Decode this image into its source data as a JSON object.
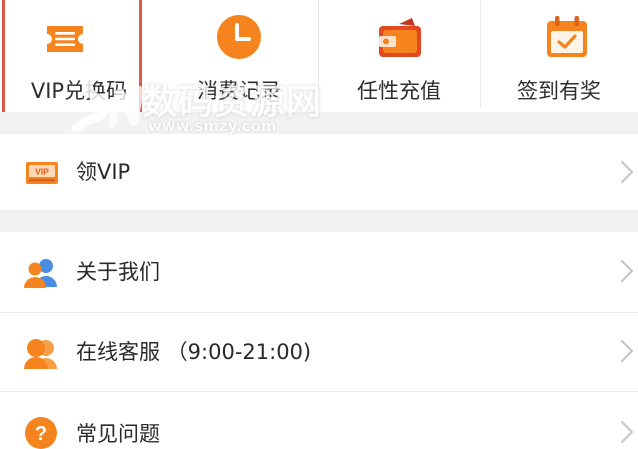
{
  "grid": {
    "items": [
      {
        "label": "VIP兑换码",
        "icon": "ticket-icon",
        "selected": true
      },
      {
        "label": "消费记录",
        "icon": "clock-icon",
        "selected": false
      },
      {
        "label": "任性充值",
        "icon": "wallet-icon",
        "selected": false
      },
      {
        "label": "签到有奖",
        "icon": "calendar-check-icon",
        "selected": false
      }
    ]
  },
  "list": {
    "get_vip": {
      "label": "领VIP",
      "icon": "vip-card-icon"
    },
    "about_us": {
      "label": "关于我们",
      "icon": "users-icon"
    },
    "online_service": {
      "label": "在线客服 （9:00-21:00)",
      "icon": "support-agent-icon"
    },
    "faq": {
      "label": "常见问题",
      "icon": "question-icon"
    }
  },
  "watermark": {
    "text": "数码资源网",
    "url": "www.smzy.com"
  },
  "colors": {
    "accent_orange": "#f5841f",
    "selected_border": "#e2574c",
    "gap_gray": "#f2f2f2",
    "chevron_gray": "#c8c8c8"
  }
}
